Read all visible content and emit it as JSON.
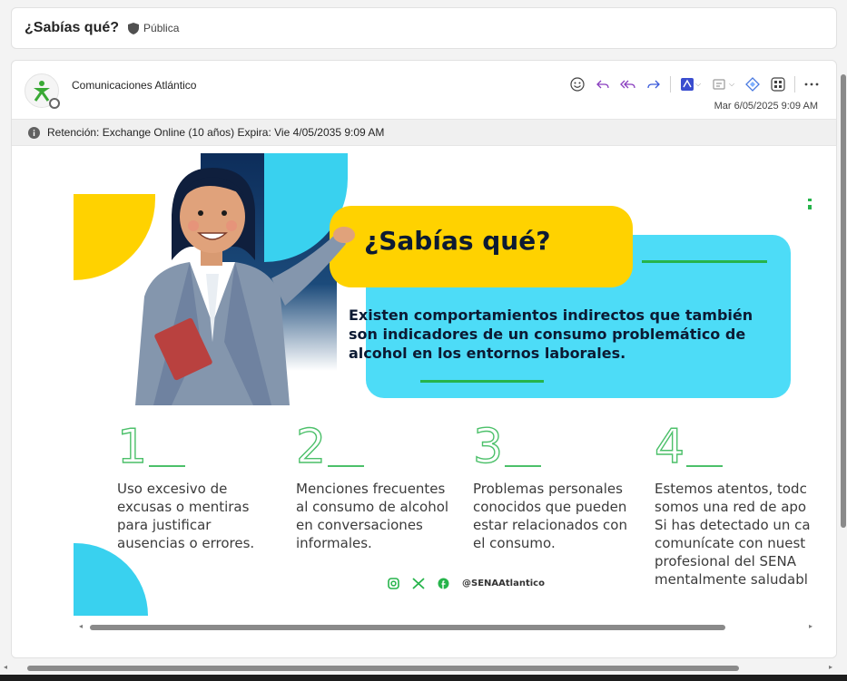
{
  "subject": {
    "title": "¿Sabías qué?",
    "label": "Pública"
  },
  "message": {
    "sender": "Comunicaciones Atlántico",
    "date": "Mar 6/05/2025 9:09 AM",
    "retention": "Retención: Exchange Online (10 años) Expira: Vie 4/05/2035 9:09 AM"
  },
  "icons": {
    "emoji": "smiley-icon",
    "reply": "reply-icon",
    "reply_all": "reply-all-icon",
    "forward": "forward-icon",
    "pdf": "adobe-pdf-icon",
    "immersive": "immersive-reader-icon",
    "loop": "loop-icon",
    "apps": "apps-icon",
    "more": "more-icon"
  },
  "colors": {
    "accent_yellow": "#ffd200",
    "accent_cyan": "#4ddcf7",
    "accent_green": "#26b44b",
    "navy": "#0c1a33"
  },
  "banner": {
    "title": "¿Sabías qué?",
    "description": "Existen comportamientos indirectos que también son indicadores de un consumo problemático de alcohol en los entornos laborales.",
    "steps": [
      {
        "number": "1",
        "text": "Uso excesivo de\nexcusas o mentiras\npara justificar\nausencias o errores."
      },
      {
        "number": "2",
        "text": "Menciones frecuentes\nal consumo de alcohol\nen conversaciones\ninformales."
      },
      {
        "number": "3",
        "text": "Problemas personales\nconocidos que pueden\nestar relacionados con\nel consumo."
      },
      {
        "number": "4",
        "text": "Estemos atentos, todc\nsomos una red de apo\nSi has detectado un ca\ncomunícate con nuest\nprofesional del SENA\nmentalmente saludabl"
      }
    ],
    "social_handle": "@SENAAtlantico"
  }
}
